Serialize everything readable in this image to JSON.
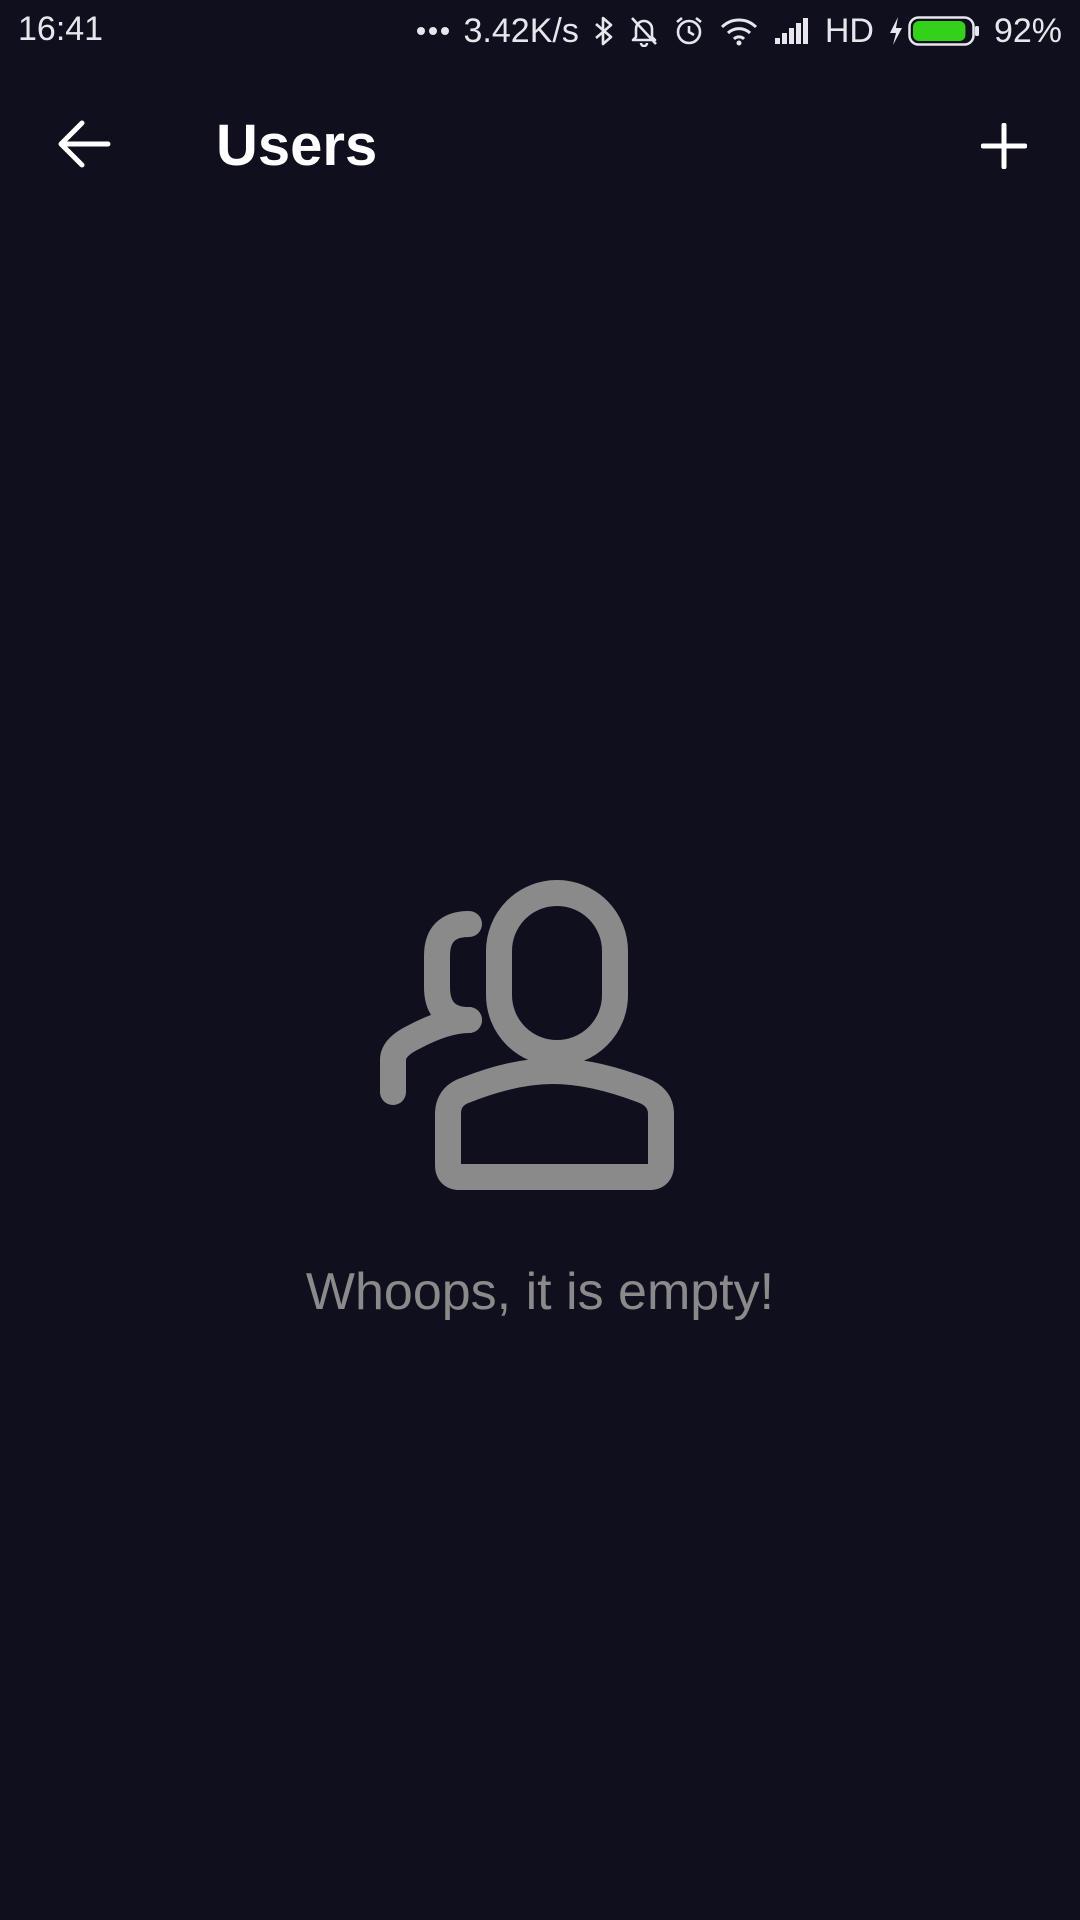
{
  "status_bar": {
    "time": "16:41",
    "network_speed": "3.42K/s",
    "network_type": "HD",
    "battery_percent": "92%",
    "battery_level": 0.92,
    "battery_color": "#33d11a",
    "icons": [
      "more-dots-icon",
      "bluetooth-icon",
      "bell-off-icon",
      "alarm-icon",
      "wifi-icon",
      "signal-icon",
      "charging-icon",
      "battery-icon"
    ]
  },
  "app_bar": {
    "title": "Users",
    "back_icon": "arrow-left-icon",
    "add_icon": "plus-icon"
  },
  "empty_state": {
    "icon": "users-icon",
    "message": "Whoops, it is empty!"
  },
  "colors": {
    "background": "#0f0f1e",
    "title": "#ffffff",
    "muted": "#8a8a8a"
  }
}
